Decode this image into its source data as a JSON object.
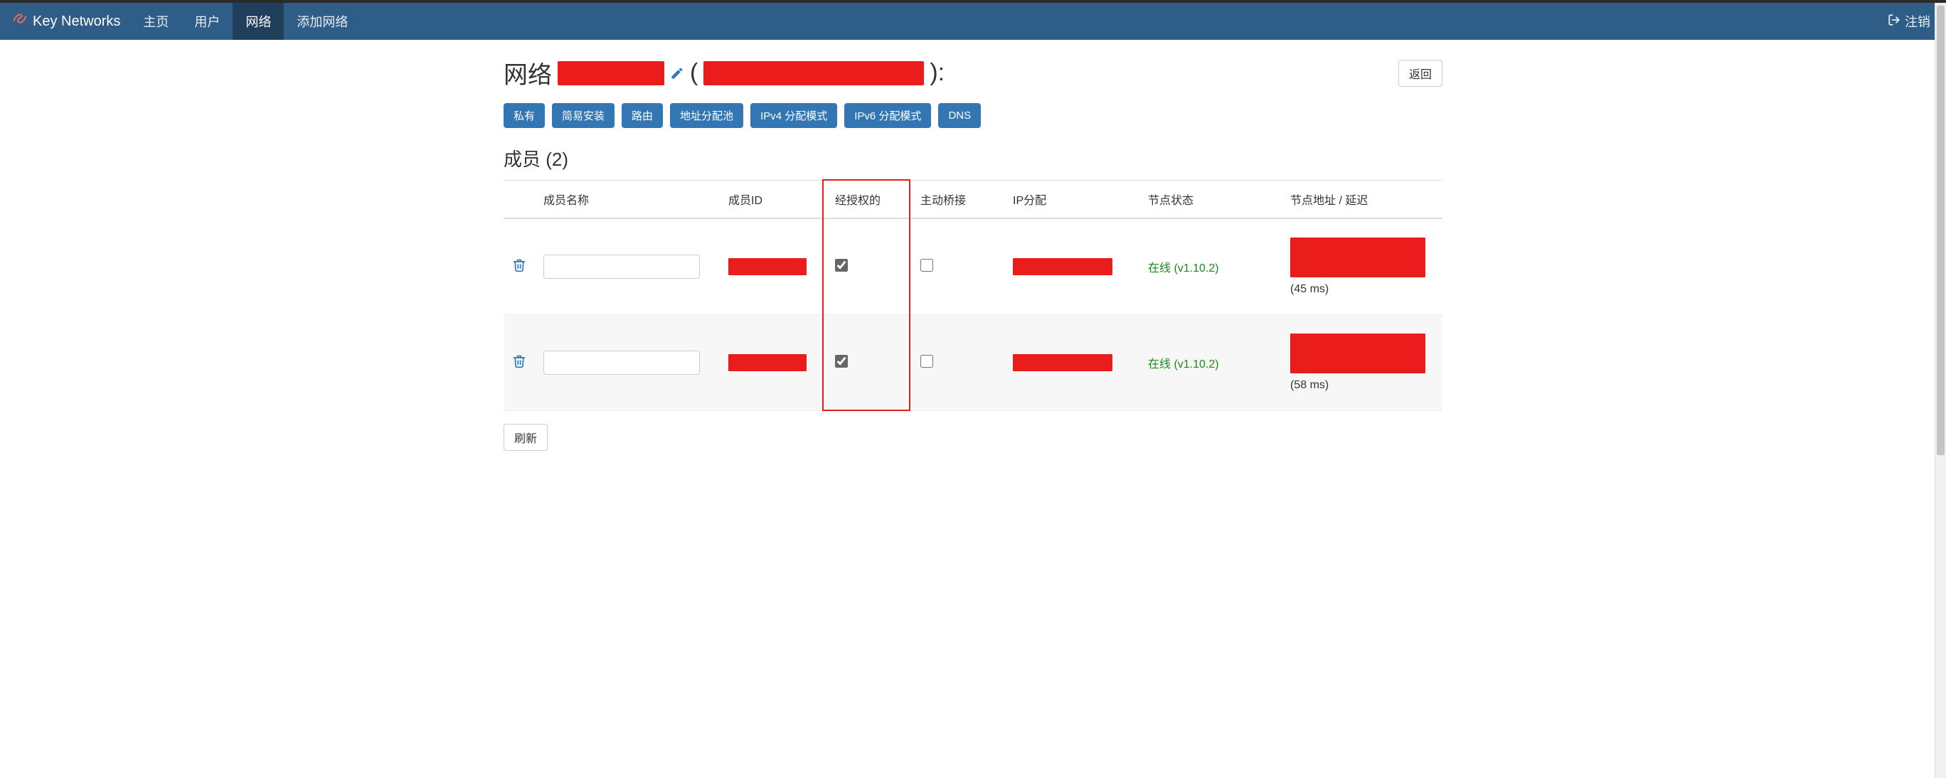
{
  "brand": "Key Networks",
  "nav": {
    "items": [
      {
        "label": "主页",
        "active": false
      },
      {
        "label": "用户",
        "active": false
      },
      {
        "label": "网络",
        "active": true
      },
      {
        "label": "添加网络",
        "active": false
      }
    ],
    "logout": "注销"
  },
  "title": {
    "prefix": "网络",
    "paren_open": "(",
    "paren_close": "):"
  },
  "back_button": "返回",
  "tabs": [
    "私有",
    "简易安装",
    "路由",
    "地址分配池",
    "IPv4 分配模式",
    "IPv6 分配模式",
    "DNS"
  ],
  "members_heading": "成员 (2)",
  "columns": {
    "name": "成员名称",
    "id": "成员ID",
    "authorized": "经授权的",
    "bridge": "主动桥接",
    "ip": "IP分配",
    "status": "节点状态",
    "address": "节点地址 / 延迟"
  },
  "rows": [
    {
      "name": "",
      "authorized": true,
      "bridge": false,
      "status": "在线 (v1.10.2)",
      "latency": "(45 ms)"
    },
    {
      "name": "",
      "authorized": true,
      "bridge": false,
      "status": "在线 (v1.10.2)",
      "latency": "(58 ms)"
    }
  ],
  "refresh": "刷新"
}
